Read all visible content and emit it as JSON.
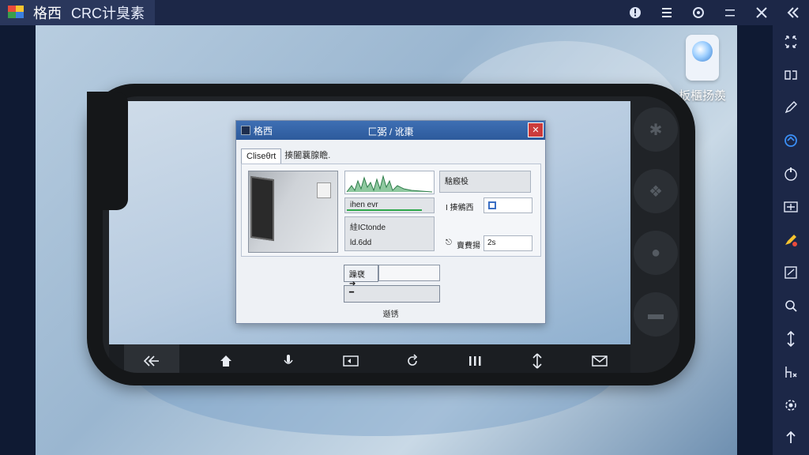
{
  "titlebar": {
    "app_name": "格西",
    "tab_label": "CRC计臭素",
    "icons": [
      "info-icon",
      "menu-icon",
      "settings-icon",
      "minimize-icon",
      "close-icon",
      "collapse-icon"
    ]
  },
  "rightbar": {
    "icons": [
      "expand-icon",
      "rotate-icon",
      "edit-icon",
      "sync-icon",
      "shake-icon",
      "keymap-icon",
      "record-icon",
      "screenshot-icon",
      "zoom-icon",
      "move-icon",
      "macro-icon",
      "gear-icon",
      "arrow-up-icon"
    ]
  },
  "shortcut": {
    "label": "板櫃扬羨"
  },
  "dialog": {
    "app_name": "格西",
    "title": "匚弼 / 讹棗",
    "tab1": "Cliseθrt",
    "tab2": "揍闔蘘腺瞻.",
    "box1_label": "騇廏杸",
    "progress_label": "ihen evr",
    "progress_value": 0.85,
    "box2_line1": "絓ICtonde",
    "box2_line2": "ld.6dd",
    "field1_label": "I 揍鵂西",
    "field2_label": "賣費揚",
    "field2_value": "2s",
    "button1_label": "躁褎 ➔",
    "button2_label": "━",
    "footer": "邎锈"
  },
  "navbar": {
    "icons": [
      "back-icon",
      "home-icon",
      "voice-icon",
      "screen-icon",
      "refresh-icon",
      "recent-apps-icon",
      "swap-icon",
      "mail-icon"
    ]
  }
}
